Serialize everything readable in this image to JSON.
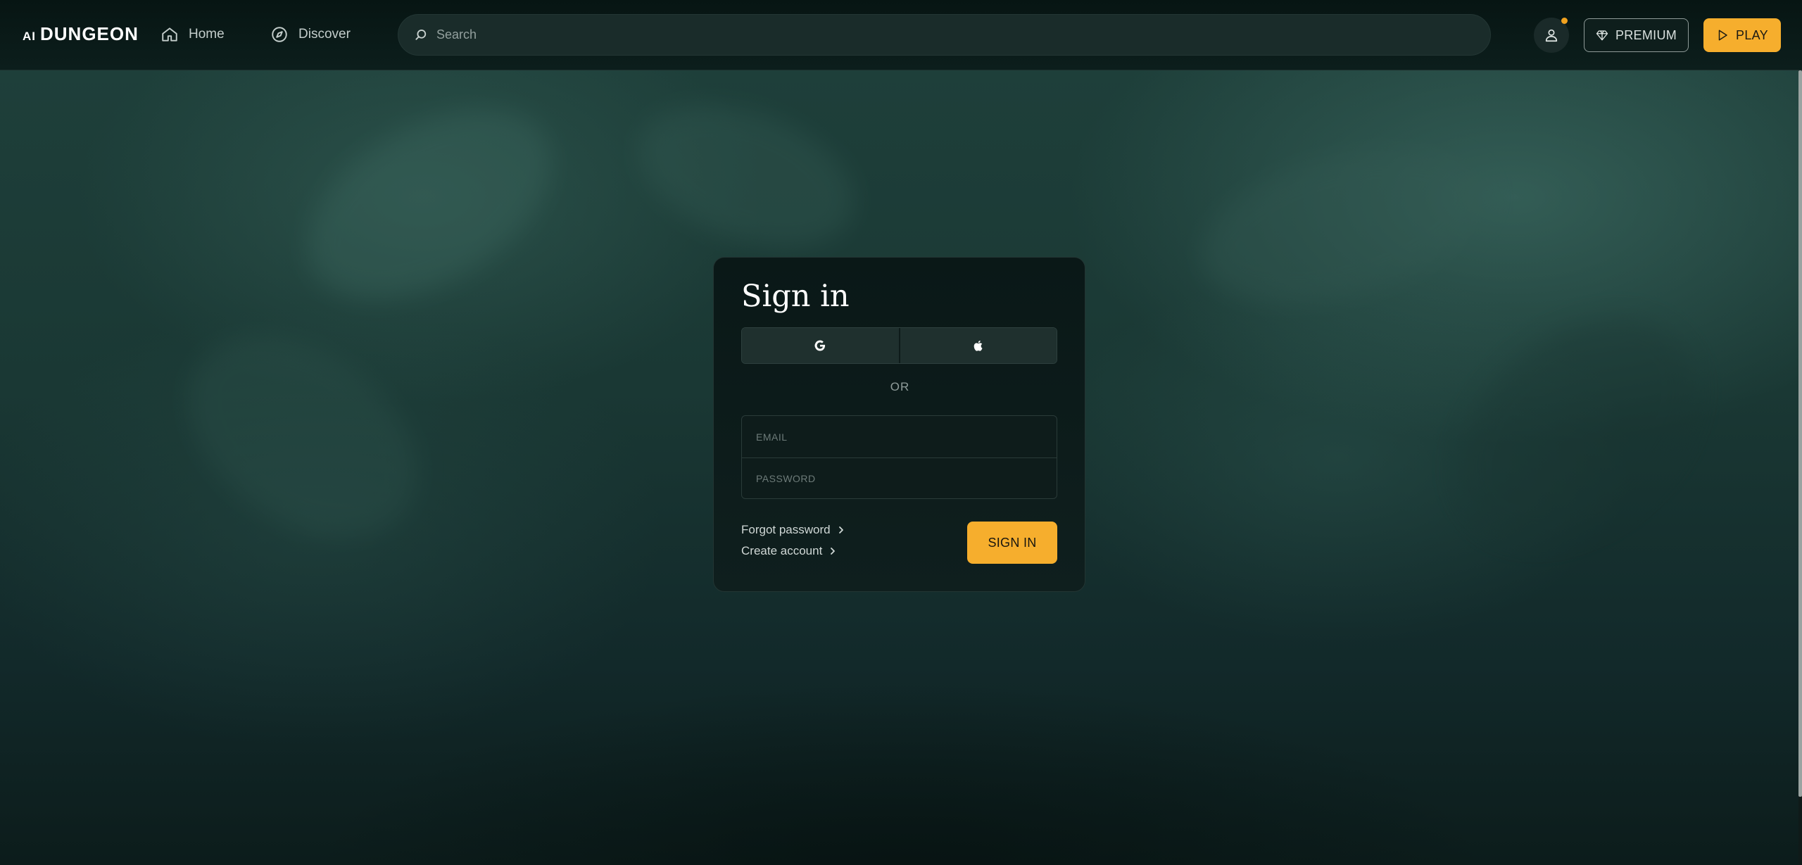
{
  "app": {
    "logo_prefix": "AI",
    "logo_name": "DUNGEON"
  },
  "nav": {
    "home_label": "Home",
    "discover_label": "Discover"
  },
  "search": {
    "placeholder": "Search"
  },
  "header_actions": {
    "premium_label": "PREMIUM",
    "play_label": "PLAY",
    "notification_dot": true
  },
  "signin_card": {
    "title": "Sign in",
    "providers": [
      "google-icon",
      "apple-icon"
    ],
    "divider_text": "OR",
    "email_placeholder": "EMAIL",
    "password_placeholder": "PASSWORD",
    "forgot_password_label": "Forgot password",
    "create_account_label": "Create account",
    "submit_label": "SIGN IN"
  },
  "colors": {
    "accent": "#f6ae2d",
    "notification": "#f0a21f",
    "header_bg": "#0c1e1c",
    "card_bg": "#0f1f1e",
    "background": "#1a3834"
  }
}
